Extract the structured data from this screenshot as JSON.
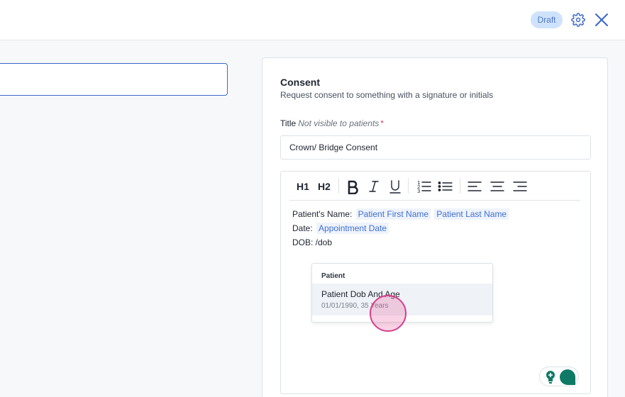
{
  "header": {
    "status_badge": "Draft",
    "icons": [
      "gear-icon",
      "close-icon"
    ]
  },
  "consent": {
    "title": "Consent",
    "description": "Request consent to something with a signature or initials",
    "field_label": "Title",
    "field_hint": "Not visible to patients",
    "required_mark": "*",
    "title_value": "Crown/ Bridge Consent"
  },
  "toolbar": {
    "h1": "H1",
    "h2": "H2",
    "icons": [
      "bold-icon",
      "italic-icon",
      "underline-icon",
      "ordered-list-icon",
      "bullet-list-icon",
      "align-left-icon",
      "align-center-icon",
      "align-right-icon"
    ]
  },
  "editor_content": {
    "line1_label": "Patient's Name:",
    "line1_chip1": "Patient First Name",
    "line1_chip2": "Patient Last Name",
    "line2_label": "Date:",
    "line2_chip": "Appointment Date",
    "line3_text": "DOB: /dob"
  },
  "dropdown": {
    "header": "Patient",
    "item_title": "Patient Dob And Age",
    "item_sub": "01/01/1990, 35 Years"
  },
  "colors": {
    "accent": "#3f6fd1",
    "badge_bg": "#cfe2fb",
    "brand_teal": "#0e7a66",
    "cursor": "#d63f8c"
  }
}
